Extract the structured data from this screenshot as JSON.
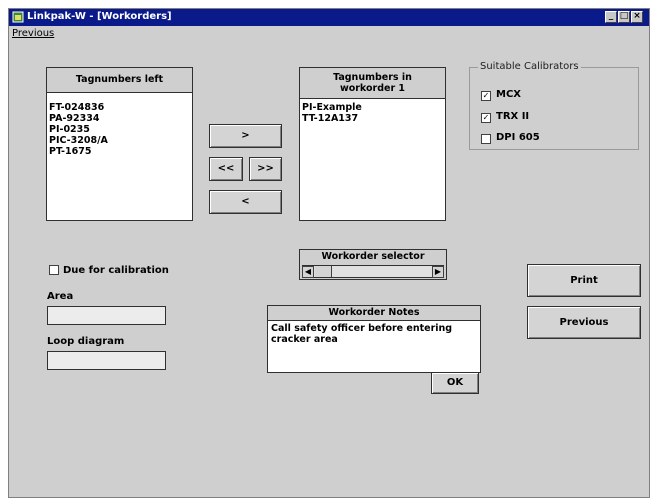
{
  "window": {
    "title": "Linkpak-W - [Workorders]"
  },
  "menu": {
    "previous": "Previous"
  },
  "tags_left": {
    "header": "Tagnumbers left",
    "items": [
      "FT-024836",
      "PA-92334",
      "PI-0235",
      "PIC-3208/A",
      "PT-1675"
    ]
  },
  "transfer_buttons": {
    "move_right": ">",
    "move_all_left": "<<",
    "move_all_right": ">>",
    "move_left": "<"
  },
  "tags_workorder": {
    "header_line1": "Tagnumbers in",
    "header_line2": "workorder 1",
    "items": [
      "PI-Example",
      "TT-12A137"
    ]
  },
  "calibrators": {
    "title": "Suitable Calibrators",
    "items": [
      {
        "label": "MCX",
        "checked": true
      },
      {
        "label": "TRX II",
        "checked": true
      },
      {
        "label": "DPI 605",
        "checked": false
      }
    ]
  },
  "workorder_selector": {
    "label": "Workorder selector"
  },
  "filters": {
    "due_for_calibration": "Due for calibration",
    "area_label": "Area",
    "area_value": "",
    "loop_label": "Loop diagram",
    "loop_value": ""
  },
  "notes": {
    "header": "Workorder Notes",
    "text": "Call safety officer before entering cracker area",
    "ok": "OK"
  },
  "actions": {
    "print": "Print",
    "previous": "Previous"
  }
}
